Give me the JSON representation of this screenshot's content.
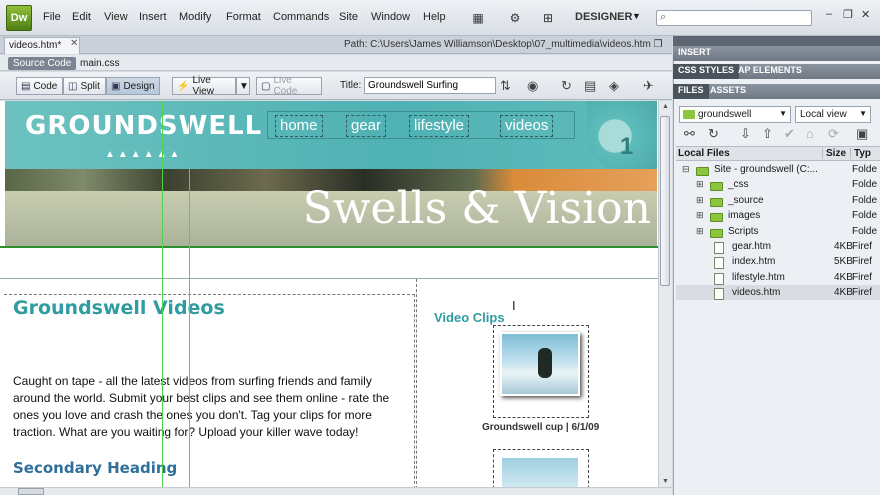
{
  "app": {
    "logo": "Dw",
    "workspace": "DESIGNER"
  },
  "menu": [
    "File",
    "Edit",
    "View",
    "Insert",
    "Modify",
    "Format",
    "Commands",
    "Site",
    "Window",
    "Help"
  ],
  "doc": {
    "tab": "videos.htm*",
    "path_label": "Path:",
    "path": "C:\\Users\\James Williamson\\Desktop\\07_multimedia\\videos.htm"
  },
  "related": {
    "source_code": "Source Code",
    "css": "main.css"
  },
  "toolbar": {
    "code": "Code",
    "split": "Split",
    "design": "Design",
    "live_view": "Live View",
    "live_code": "Live Code",
    "title_label": "Title:",
    "title_value": "Groundswell Surfing"
  },
  "page": {
    "brand": "GROUNDSWELL",
    "nav": [
      "home",
      "gear",
      "lifestyle",
      "videos"
    ],
    "badge": "1",
    "banner": "Swells & Vision",
    "heading": "Groundswell Videos",
    "intro": "Caught on tape - all the latest videos from surfing friends and family around the world. Submit your best clips and see them online - rate the ones you love and crash the ones you don't. Tag your clips for more traction. What are you waiting for? Upload your killer wave today!",
    "secondary": "Secondary Heading",
    "clips_heading": "Video Clips",
    "clip_caption": "Groundswell cup | 6/1/09"
  },
  "panel": {
    "insert": "INSERT",
    "tabs1": [
      "CSS STYLES",
      "AP ELEMENTS"
    ],
    "tabs2": [
      "FILES",
      "ASSETS"
    ],
    "site": "groundswell",
    "view": "Local view",
    "cols": {
      "name": "Local Files",
      "size": "Size",
      "type": "Typ"
    },
    "files": [
      {
        "name": "Site - groundswell (C:...",
        "size": "",
        "type": "Folde",
        "kind": "site"
      },
      {
        "name": "_css",
        "size": "",
        "type": "Folde",
        "kind": "folder"
      },
      {
        "name": "_source",
        "size": "",
        "type": "Folde",
        "kind": "folder"
      },
      {
        "name": "images",
        "size": "",
        "type": "Folde",
        "kind": "folder"
      },
      {
        "name": "Scripts",
        "size": "",
        "type": "Folde",
        "kind": "folder"
      },
      {
        "name": "gear.htm",
        "size": "4KB",
        "type": "Firef",
        "kind": "file"
      },
      {
        "name": "index.htm",
        "size": "5KB",
        "type": "Firef",
        "kind": "file"
      },
      {
        "name": "lifestyle.htm",
        "size": "4KB",
        "type": "Firef",
        "kind": "file"
      },
      {
        "name": "videos.htm",
        "size": "4KB",
        "type": "Firef",
        "kind": "file"
      }
    ]
  }
}
